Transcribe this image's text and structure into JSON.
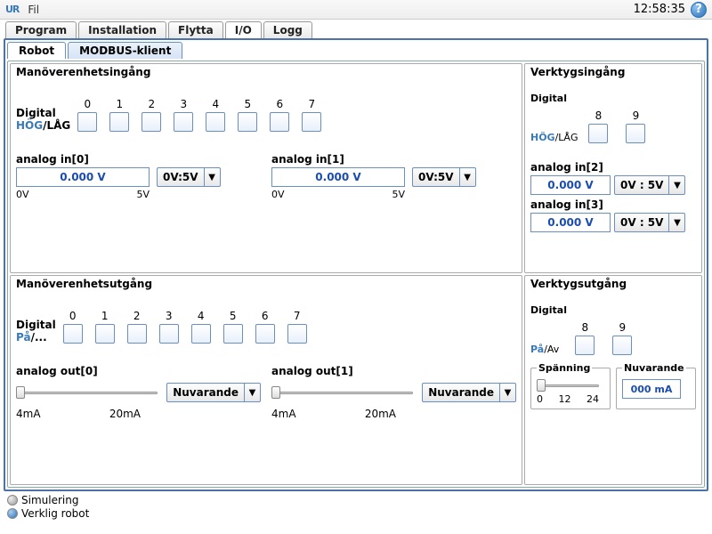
{
  "topbar": {
    "logo": "UR",
    "menu_file": "Fil",
    "clock": "12:58:35",
    "help": "?"
  },
  "main_tabs": [
    "Program",
    "Installation",
    "Flytta",
    "I/O",
    "Logg"
  ],
  "main_tab_active": 3,
  "sub_tabs": [
    "Robot",
    "MODBUS-klient"
  ],
  "sub_tab_active": 0,
  "sections": {
    "ctrl_in": {
      "title": "Manöverenhetsingång",
      "digital_label": "Digital",
      "hog": "HÖG",
      "lag": "/LÅG",
      "nums": [
        "0",
        "1",
        "2",
        "3",
        "4",
        "5",
        "6",
        "7"
      ]
    },
    "ctrl_out": {
      "title": "Manöverenhetsutgång",
      "digital_label": "Digital",
      "pa": "På",
      "av": "/...",
      "nums": [
        "0",
        "1",
        "2",
        "3",
        "4",
        "5",
        "6",
        "7"
      ]
    },
    "tool_in": {
      "title": "Verktygsingång",
      "digital_label": "Digital",
      "hog": "HÖG",
      "lag": "/LÅG",
      "nums": [
        "8",
        "9"
      ]
    },
    "tool_out": {
      "title": "Verktygsutgång",
      "digital_label": "Digital",
      "pa": "På",
      "av": "/Av",
      "nums": [
        "8",
        "9"
      ]
    }
  },
  "analog_in": [
    {
      "label": "analog in[0]",
      "value": "0.000 V",
      "range": "0V:5V",
      "lo": "0V",
      "hi": "5V"
    },
    {
      "label": "analog in[1]",
      "value": "0.000 V",
      "range": "0V:5V",
      "lo": "0V",
      "hi": "5V"
    }
  ],
  "tool_analog_in": [
    {
      "label": "analog in[2]",
      "value": "0.000 V",
      "range": "0V : 5V"
    },
    {
      "label": "analog in[3]",
      "value": "0.000 V",
      "range": "0V : 5V"
    }
  ],
  "analog_out": [
    {
      "label": "analog out[0]",
      "mode": "Nuvarande",
      "lo": "4mA",
      "hi": "20mA"
    },
    {
      "label": "analog out[1]",
      "mode": "Nuvarande",
      "lo": "4mA",
      "hi": "20mA"
    }
  ],
  "tool_out_groups": {
    "voltage": {
      "legend": "Spänning",
      "ticks": [
        "0",
        "12",
        "24"
      ]
    },
    "current": {
      "legend": "Nuvarande",
      "value": "000 mA"
    }
  },
  "footer": {
    "sim": "Simulering",
    "real": "Verklig robot"
  }
}
